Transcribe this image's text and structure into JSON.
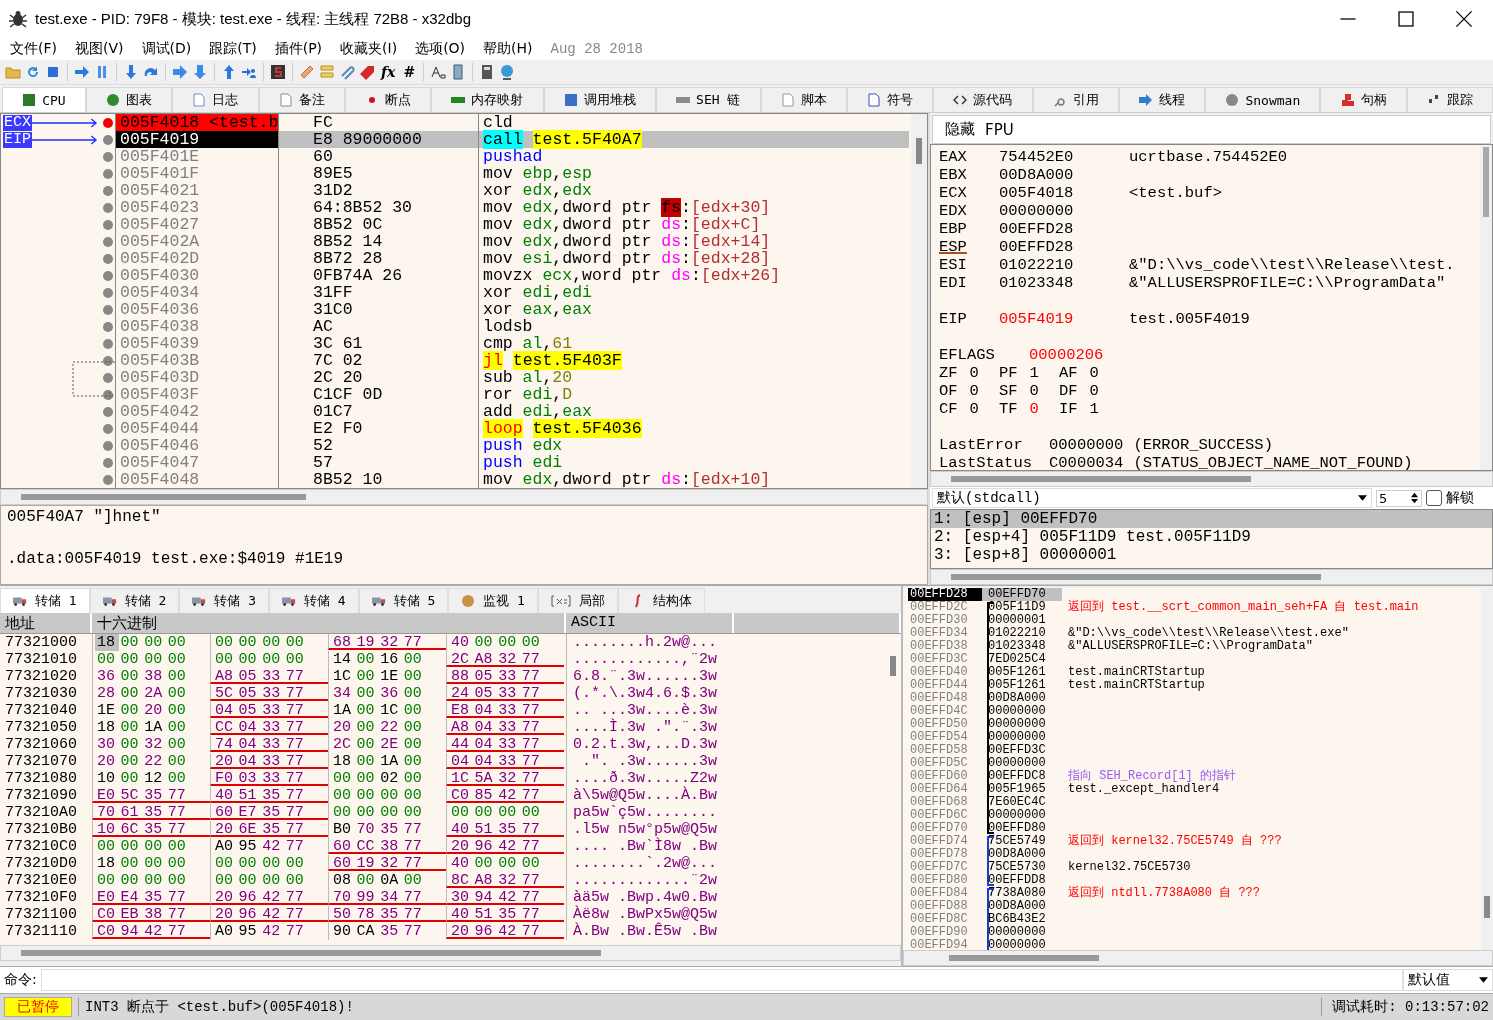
{
  "window": {
    "title": "test.exe - PID: 79F8 - 模块: test.exe - 线程: 主线程 72B8 - x32dbg"
  },
  "menu": [
    "文件(F)",
    "视图(V)",
    "调试(D)",
    "跟踪(T)",
    "插件(P)",
    "收藏夹(I)",
    "选项(O)",
    "帮助(H)"
  ],
  "build_date": "Aug 28 2018",
  "toolbar_glyphs": [
    "fx",
    "#"
  ],
  "tabs": [
    {
      "label": "CPU",
      "selected": true
    },
    {
      "label": "图表",
      "selected": false
    },
    {
      "label": "日志",
      "selected": false
    },
    {
      "label": "备注",
      "selected": false
    },
    {
      "label": "断点",
      "selected": false
    },
    {
      "label": "内存映射",
      "selected": false
    },
    {
      "label": "调用堆栈",
      "selected": false
    },
    {
      "label": "SEH 链",
      "selected": false
    },
    {
      "label": "脚本",
      "selected": false
    },
    {
      "label": "符号",
      "selected": false
    },
    {
      "label": "源代码",
      "selected": false
    },
    {
      "label": "引用",
      "selected": false
    },
    {
      "label": "线程",
      "selected": false
    },
    {
      "label": "Snowman",
      "selected": false
    },
    {
      "label": "句柄",
      "selected": false
    },
    {
      "label": "跟踪",
      "selected": false
    }
  ],
  "disassembly": {
    "rows": [
      {
        "pointer": "ECX",
        "address": "005F4018 <test.b",
        "bytes": "FC",
        "breakpoint": true,
        "current": false,
        "tokens": [
          {
            "kind": "op",
            "text": "cld"
          }
        ]
      },
      {
        "pointer": "EIP",
        "address": "005F4019",
        "bytes": "E8 89000000",
        "breakpoint": false,
        "current": true,
        "tokens": [
          {
            "kind": "call",
            "text": "call"
          },
          {
            "kind": "label",
            "text": "test.5F40A7"
          }
        ]
      },
      {
        "address": "005F401E",
        "bytes": "60",
        "breakpoint": false,
        "current": false,
        "tokens": [
          {
            "kind": "push",
            "text": "pushad"
          }
        ]
      },
      {
        "address": "005F401F",
        "bytes": "89E5",
        "breakpoint": false,
        "current": false,
        "tokens": [
          {
            "kind": "op",
            "text": "mov "
          },
          {
            "kind": "reg",
            "text": "ebp"
          },
          {
            "kind": "op",
            "text": ","
          },
          {
            "kind": "reg",
            "text": "esp"
          }
        ]
      },
      {
        "address": "005F4021",
        "bytes": "31D2",
        "breakpoint": false,
        "current": false,
        "tokens": [
          {
            "kind": "op",
            "text": "xor "
          },
          {
            "kind": "reg",
            "text": "edx"
          },
          {
            "kind": "op",
            "text": ","
          },
          {
            "kind": "reg",
            "text": "edx"
          }
        ]
      },
      {
        "address": "005F4023",
        "bytes": "64:8B52 30",
        "breakpoint": false,
        "current": false,
        "tokens": [
          {
            "kind": "op",
            "text": "mov "
          },
          {
            "kind": "reg",
            "text": "edx"
          },
          {
            "kind": "op",
            "text": ",dword ptr "
          },
          {
            "kind": "segx",
            "text": "fs"
          },
          {
            "kind": "op",
            "text": ":"
          },
          {
            "kind": "mem",
            "text": "[edx+30]"
          }
        ]
      },
      {
        "address": "005F4027",
        "bytes": "8B52 0C",
        "breakpoint": false,
        "current": false,
        "tokens": [
          {
            "kind": "op",
            "text": "mov "
          },
          {
            "kind": "reg",
            "text": "edx"
          },
          {
            "kind": "op",
            "text": ",dword ptr "
          },
          {
            "kind": "seg",
            "text": "ds"
          },
          {
            "kind": "op",
            "text": ":"
          },
          {
            "kind": "mem",
            "text": "[edx+C]"
          }
        ]
      },
      {
        "address": "005F402A",
        "bytes": "8B52 14",
        "breakpoint": false,
        "current": false,
        "tokens": [
          {
            "kind": "op",
            "text": "mov "
          },
          {
            "kind": "reg",
            "text": "edx"
          },
          {
            "kind": "op",
            "text": ",dword ptr "
          },
          {
            "kind": "seg",
            "text": "ds"
          },
          {
            "kind": "op",
            "text": ":"
          },
          {
            "kind": "mem",
            "text": "[edx+14]"
          }
        ]
      },
      {
        "address": "005F402D",
        "bytes": "8B72 28",
        "breakpoint": false,
        "current": false,
        "tokens": [
          {
            "kind": "op",
            "text": "mov "
          },
          {
            "kind": "reg",
            "text": "esi"
          },
          {
            "kind": "op",
            "text": ",dword ptr "
          },
          {
            "kind": "seg",
            "text": "ds"
          },
          {
            "kind": "op",
            "text": ":"
          },
          {
            "kind": "mem",
            "text": "[edx+28]"
          }
        ]
      },
      {
        "address": "005F4030",
        "bytes": "0FB74A 26",
        "breakpoint": false,
        "current": false,
        "tokens": [
          {
            "kind": "op",
            "text": "movzx "
          },
          {
            "kind": "reg",
            "text": "ecx"
          },
          {
            "kind": "op",
            "text": ",word ptr "
          },
          {
            "kind": "seg",
            "text": "ds"
          },
          {
            "kind": "op",
            "text": ":"
          },
          {
            "kind": "mem",
            "text": "[edx+26]"
          }
        ]
      },
      {
        "address": "005F4034",
        "bytes": "31FF",
        "breakpoint": false,
        "current": false,
        "tokens": [
          {
            "kind": "op",
            "text": "xor "
          },
          {
            "kind": "reg",
            "text": "edi"
          },
          {
            "kind": "op",
            "text": ","
          },
          {
            "kind": "reg",
            "text": "edi"
          }
        ]
      },
      {
        "address": "005F4036",
        "bytes": "31C0",
        "breakpoint": false,
        "current": false,
        "tokens": [
          {
            "kind": "op",
            "text": "xor "
          },
          {
            "kind": "reg",
            "text": "eax"
          },
          {
            "kind": "op",
            "text": ","
          },
          {
            "kind": "reg",
            "text": "eax"
          }
        ]
      },
      {
        "address": "005F4038",
        "bytes": "AC",
        "breakpoint": false,
        "current": false,
        "tokens": [
          {
            "kind": "op",
            "text": "lodsb"
          }
        ]
      },
      {
        "address": "005F4039",
        "bytes": "3C 61",
        "breakpoint": false,
        "current": false,
        "tokens": [
          {
            "kind": "op",
            "text": "cmp "
          },
          {
            "kind": "reg",
            "text": "al"
          },
          {
            "kind": "op",
            "text": ","
          },
          {
            "kind": "num",
            "text": "61"
          }
        ]
      },
      {
        "address": "005F403B",
        "bytes": "7C 02",
        "breakpoint": false,
        "current": false,
        "tokens": [
          {
            "kind": "jump",
            "text": "jl"
          },
          {
            "kind": "label",
            "text": "test.5F403F"
          }
        ]
      },
      {
        "address": "005F403D",
        "bytes": "2C 20",
        "breakpoint": false,
        "current": false,
        "tokens": [
          {
            "kind": "op",
            "text": "sub "
          },
          {
            "kind": "reg",
            "text": "al"
          },
          {
            "kind": "op",
            "text": ","
          },
          {
            "kind": "num",
            "text": "20"
          }
        ]
      },
      {
        "address": "005F403F",
        "bytes": "C1CF 0D",
        "breakpoint": false,
        "current": false,
        "tokens": [
          {
            "kind": "op",
            "text": "ror "
          },
          {
            "kind": "reg",
            "text": "edi"
          },
          {
            "kind": "op",
            "text": ","
          },
          {
            "kind": "num",
            "text": "D"
          }
        ]
      },
      {
        "address": "005F4042",
        "bytes": "01C7",
        "breakpoint": false,
        "current": false,
        "tokens": [
          {
            "kind": "op",
            "text": "add "
          },
          {
            "kind": "reg",
            "text": "edi"
          },
          {
            "kind": "op",
            "text": ","
          },
          {
            "kind": "reg",
            "text": "eax"
          }
        ]
      },
      {
        "address": "005F4044",
        "bytes": "E2 F0",
        "breakpoint": false,
        "current": false,
        "tokens": [
          {
            "kind": "jump",
            "text": "loop"
          },
          {
            "kind": "label",
            "text": "test.5F4036"
          }
        ]
      },
      {
        "address": "005F4046",
        "bytes": "52",
        "breakpoint": false,
        "current": false,
        "tokens": [
          {
            "kind": "push",
            "text": "push "
          },
          {
            "kind": "reg",
            "text": "edx"
          }
        ]
      },
      {
        "address": "005F4047",
        "bytes": "57",
        "breakpoint": false,
        "current": false,
        "tokens": [
          {
            "kind": "push",
            "text": "push "
          },
          {
            "kind": "reg",
            "text": "edi"
          }
        ]
      },
      {
        "address": "005F4048",
        "bytes": "8B52 10",
        "breakpoint": false,
        "current": false,
        "tokens": [
          {
            "kind": "op",
            "text": "mov "
          },
          {
            "kind": "reg",
            "text": "edx"
          },
          {
            "kind": "op",
            "text": ",dword ptr "
          },
          {
            "kind": "seg",
            "text": "ds"
          },
          {
            "kind": "op",
            "text": ":"
          },
          {
            "kind": "mem",
            "text": "[edx+10]"
          }
        ]
      }
    ]
  },
  "info_lines": [
    "005F40A7 \"]hnet\"",
    ".data:005F4019 test.exe:$4019 #1E19"
  ],
  "registers": {
    "buttons": [
      "隐藏",
      "FPU"
    ],
    "groups": [
      [
        {
          "name": "EAX",
          "value": "754452E0",
          "comment": "ucrtbase.754452E0",
          "changed": false,
          "marked": false
        },
        {
          "name": "EBX",
          "value": "00D8A000",
          "changed": false,
          "marked": false
        },
        {
          "name": "ECX",
          "value": "005F4018",
          "comment": "<test.buf>",
          "changed": false,
          "marked": false
        },
        {
          "name": "EDX",
          "value": "00000000",
          "changed": false,
          "marked": false
        },
        {
          "name": "EBP",
          "value": "00EFFD28",
          "changed": false,
          "marked": false
        },
        {
          "name": "ESP",
          "value": "00EFFD28",
          "changed": false,
          "marked": true
        },
        {
          "name": "ESI",
          "value": "01022210",
          "comment": "&\"D:\\\\vs_code\\\\test\\\\Release\\\\test.",
          "changed": false,
          "marked": false
        },
        {
          "name": "EDI",
          "value": "01023348",
          "comment": "&\"ALLUSERSPROFILE=C:\\\\ProgramData\"",
          "changed": false,
          "marked": false
        }
      ],
      [
        {
          "name": "EIP",
          "value": "005F4019",
          "comment": "test.005F4019",
          "changed": true,
          "marked": false
        }
      ]
    ],
    "eflags": {
      "name": "EFLAGS",
      "value": "00000206",
      "changed": true
    },
    "flags": [
      [
        {
          "name": "ZF",
          "value": "0",
          "changed": false
        },
        {
          "name": "PF",
          "value": "1",
          "changed": false
        },
        {
          "name": "AF",
          "value": "0",
          "changed": false
        }
      ],
      [
        {
          "name": "OF",
          "value": "0",
          "changed": false
        },
        {
          "name": "SF",
          "value": "0",
          "changed": false
        },
        {
          "name": "DF",
          "value": "0",
          "changed": false
        }
      ],
      [
        {
          "name": "CF",
          "value": "0",
          "changed": false
        },
        {
          "name": "TF",
          "value": "0",
          "changed": true
        },
        {
          "name": "IF",
          "value": "1",
          "changed": false
        }
      ]
    ],
    "status": [
      {
        "name": "LastError",
        "value": "00000000",
        "note": "(ERROR_SUCCESS)"
      },
      {
        "name": "LastStatus",
        "value": "C0000034",
        "note": "(STATUS_OBJECT_NAME_NOT_FOUND)"
      }
    ]
  },
  "arguments": {
    "convention": "默认(stdcall)",
    "count": "5",
    "unlock": {
      "label": "解锁",
      "checked": false
    },
    "rows": [
      {
        "text": "1: [esp] 00EFFD70",
        "selected": true
      },
      {
        "text": "2: [esp+4] 005F11D9 test.005F11D9",
        "selected": false
      },
      {
        "text": "3: [esp+8] 00000001",
        "selected": false
      }
    ]
  },
  "dump": {
    "tabs": [
      {
        "label": "转储 1",
        "selected": true
      },
      {
        "label": "转储 2",
        "selected": false
      },
      {
        "label": "转储 3",
        "selected": false
      },
      {
        "label": "转储 4",
        "selected": false
      },
      {
        "label": "转储 5",
        "selected": false
      },
      {
        "label": "监视 1",
        "selected": false
      },
      {
        "label": "局部",
        "selected": false
      },
      {
        "label": "结构体",
        "selected": false
      }
    ],
    "columns": [
      "地址",
      "十六进制",
      "ASCII"
    ],
    "rows": [
      {
        "address": "77321000",
        "selected": true,
        "groups": [
          {
            "bytes": "18 00 00 00",
            "pointer": false
          },
          {
            "bytes": "00 00 00 00",
            "pointer": false
          },
          {
            "bytes": "68 19 32 77",
            "pointer": true
          },
          {
            "bytes": "40 00 00 00",
            "pointer": false
          }
        ],
        "ascii": "........h.2w@..."
      },
      {
        "address": "77321010",
        "selected": false,
        "groups": [
          {
            "bytes": "00 00 00 00",
            "pointer": false
          },
          {
            "bytes": "00 00 00 00",
            "pointer": false
          },
          {
            "bytes": "14 00 16 00",
            "pointer": false
          },
          {
            "bytes": "2C A8 32 77",
            "pointer": true
          }
        ],
        "ascii": "............,¨2w"
      },
      {
        "address": "77321020",
        "selected": false,
        "groups": [
          {
            "bytes": "36 00 38 00",
            "pointer": false
          },
          {
            "bytes": "A8 05 33 77",
            "pointer": true
          },
          {
            "bytes": "1C 00 1E 00",
            "pointer": false
          },
          {
            "bytes": "88 05 33 77",
            "pointer": true
          }
        ],
        "ascii": "6.8.¨.3w......3w"
      },
      {
        "address": "77321030",
        "selected": false,
        "groups": [
          {
            "bytes": "28 00 2A 00",
            "pointer": false
          },
          {
            "bytes": "5C 05 33 77",
            "pointer": true
          },
          {
            "bytes": "34 00 36 00",
            "pointer": false
          },
          {
            "bytes": "24 05 33 77",
            "pointer": true
          }
        ],
        "ascii": "(.*.\\.3w4.6.$.3w"
      },
      {
        "address": "77321040",
        "selected": false,
        "groups": [
          {
            "bytes": "1E 00 20 00",
            "pointer": false
          },
          {
            "bytes": "04 05 33 77",
            "pointer": true
          },
          {
            "bytes": "1A 00 1C 00",
            "pointer": false
          },
          {
            "bytes": "E8 04 33 77",
            "pointer": true
          }
        ],
        "ascii": ".. ...3w....è.3w"
      },
      {
        "address": "77321050",
        "selected": false,
        "groups": [
          {
            "bytes": "18 00 1A 00",
            "pointer": false
          },
          {
            "bytes": "CC 04 33 77",
            "pointer": true
          },
          {
            "bytes": "20 00 22 00",
            "pointer": false
          },
          {
            "bytes": "A8 04 33 77",
            "pointer": true
          }
        ],
        "ascii": "....Ì.3w .\".¨.3w"
      },
      {
        "address": "77321060",
        "selected": false,
        "groups": [
          {
            "bytes": "30 00 32 00",
            "pointer": false
          },
          {
            "bytes": "74 04 33 77",
            "pointer": true
          },
          {
            "bytes": "2C 00 2E 00",
            "pointer": false
          },
          {
            "bytes": "44 04 33 77",
            "pointer": true
          }
        ],
        "ascii": "0.2.t.3w,...D.3w"
      },
      {
        "address": "77321070",
        "selected": false,
        "groups": [
          {
            "bytes": "20 00 22 00",
            "pointer": false
          },
          {
            "bytes": "20 04 33 77",
            "pointer": true
          },
          {
            "bytes": "18 00 1A 00",
            "pointer": false
          },
          {
            "bytes": "04 04 33 77",
            "pointer": true
          }
        ],
        "ascii": " .\". .3w......3w"
      },
      {
        "address": "77321080",
        "selected": false,
        "groups": [
          {
            "bytes": "10 00 12 00",
            "pointer": false
          },
          {
            "bytes": "F0 03 33 77",
            "pointer": true
          },
          {
            "bytes": "00 00 02 00",
            "pointer": false
          },
          {
            "bytes": "1C 5A 32 77",
            "pointer": true
          }
        ],
        "ascii": "....ð.3w.....Z2w"
      },
      {
        "address": "77321090",
        "selected": false,
        "groups": [
          {
            "bytes": "E0 5C 35 77",
            "pointer": true
          },
          {
            "bytes": "40 51 35 77",
            "pointer": true
          },
          {
            "bytes": "00 00 00 00",
            "pointer": false
          },
          {
            "bytes": "C0 85 42 77",
            "pointer": true
          }
        ],
        "ascii": "à\\5w@Q5w....À.Bw"
      },
      {
        "address": "773210A0",
        "selected": false,
        "groups": [
          {
            "bytes": "70 61 35 77",
            "pointer": true
          },
          {
            "bytes": "60 E7 35 77",
            "pointer": true
          },
          {
            "bytes": "00 00 00 00",
            "pointer": false
          },
          {
            "bytes": "00 00 00 00",
            "pointer": false
          }
        ],
        "ascii": "pa5w`ç5w........"
      },
      {
        "address": "773210B0",
        "selected": false,
        "groups": [
          {
            "bytes": "10 6C 35 77",
            "pointer": true
          },
          {
            "bytes": "20 6E 35 77",
            "pointer": true
          },
          {
            "bytes": "B0 70 35 77",
            "pointer": false
          },
          {
            "bytes": "40 51 35 77",
            "pointer": true
          }
        ],
        "ascii": ".l5w n5w°p5w@Q5w"
      },
      {
        "address": "773210C0",
        "selected": false,
        "groups": [
          {
            "bytes": "00 00 00 00",
            "pointer": false
          },
          {
            "bytes": "A0 95 42 77",
            "pointer": false
          },
          {
            "bytes": "60 CC 38 77",
            "pointer": true
          },
          {
            "bytes": "20 96 42 77",
            "pointer": true
          }
        ],
        "ascii": ".... .Bw`Ì8w .Bw"
      },
      {
        "address": "773210D0",
        "selected": false,
        "groups": [
          {
            "bytes": "18 00 00 00",
            "pointer": false
          },
          {
            "bytes": "00 00 00 00",
            "pointer": false
          },
          {
            "bytes": "60 19 32 77",
            "pointer": true
          },
          {
            "bytes": "40 00 00 00",
            "pointer": false
          }
        ],
        "ascii": "........`.2w@..."
      },
      {
        "address": "773210E0",
        "selected": false,
        "groups": [
          {
            "bytes": "00 00 00 00",
            "pointer": false
          },
          {
            "bytes": "00 00 00 00",
            "pointer": false
          },
          {
            "bytes": "08 00 0A 00",
            "pointer": false
          },
          {
            "bytes": "8C A8 32 77",
            "pointer": true
          }
        ],
        "ascii": ".............¨2w"
      },
      {
        "address": "773210F0",
        "selected": false,
        "groups": [
          {
            "bytes": "E0 E4 35 77",
            "pointer": true
          },
          {
            "bytes": "20 96 42 77",
            "pointer": true
          },
          {
            "bytes": "70 99 34 77",
            "pointer": true
          },
          {
            "bytes": "30 94 42 77",
            "pointer": true
          }
        ],
        "ascii": "àä5w .Bwp.4w0.Bw"
      },
      {
        "address": "77321100",
        "selected": false,
        "groups": [
          {
            "bytes": "C0 EB 38 77",
            "pointer": true
          },
          {
            "bytes": "20 96 42 77",
            "pointer": true
          },
          {
            "bytes": "50 78 35 77",
            "pointer": true
          },
          {
            "bytes": "40 51 35 77",
            "pointer": true
          }
        ],
        "ascii": "Àë8w .BwPx5w@Q5w"
      },
      {
        "address": "77321110",
        "selected": false,
        "groups": [
          {
            "bytes": "C0 94 42 77",
            "pointer": true
          },
          {
            "bytes": "A0 95 42 77",
            "pointer": false
          },
          {
            "bytes": "90 CA 35 77",
            "pointer": false
          },
          {
            "bytes": "20 96 42 77",
            "pointer": true
          }
        ],
        "ascii": "À.Bw .Bw.Ê5w .Bw"
      }
    ]
  },
  "stack": {
    "top": {
      "address": "00EFFD28",
      "value": "00EFFD70"
    },
    "frames": [
      {
        "color": "#000000",
        "closed": true,
        "rows": [
          {
            "address": "00EFFD2C",
            "value": "005F11D9",
            "comment": "返回到 test.__scrt_common_main_seh+FA 自 test.main",
            "kind": "return"
          },
          {
            "address": "00EFFD30",
            "value": "00000001"
          },
          {
            "address": "00EFFD34",
            "value": "01022210",
            "comment": "&\"D:\\\\vs_code\\\\test\\\\Release\\\\test.exe\"",
            "kind": "plain"
          },
          {
            "address": "00EFFD38",
            "value": "01023348",
            "comment": "&\"ALLUSERSPROFILE=C:\\\\ProgramData\"",
            "kind": "plain"
          },
          {
            "address": "00EFFD3C",
            "value": "7ED025C4"
          },
          {
            "address": "00EFFD40",
            "value": "005F1261",
            "comment": "test.mainCRTStartup",
            "kind": "plain"
          },
          {
            "address": "00EFFD44",
            "value": "005F1261",
            "comment": "test.mainCRTStartup",
            "kind": "plain"
          },
          {
            "address": "00EFFD48",
            "value": "00D8A000"
          },
          {
            "address": "00EFFD4C",
            "value": "00000000"
          },
          {
            "address": "00EFFD50",
            "value": "00000000"
          },
          {
            "address": "00EFFD54",
            "value": "00000000"
          },
          {
            "address": "00EFFD58",
            "value": "00EFFD3C"
          },
          {
            "address": "00EFFD5C",
            "value": "00000000"
          },
          {
            "address": "00EFFD60",
            "value": "00EFFDC8",
            "comment": "指向 SEH_Record[1] 的指针",
            "kind": "seh"
          },
          {
            "address": "00EFFD64",
            "value": "005F1965",
            "comment": "test._except_handler4",
            "kind": "plain"
          },
          {
            "address": "00EFFD68",
            "value": "7E60EC4C"
          },
          {
            "address": "00EFFD6C",
            "value": "00000000"
          },
          {
            "address": "00EFFD70",
            "value": "00EFFD80"
          }
        ]
      },
      {
        "color": "#1a3cc8",
        "closed": true,
        "rows": [
          {
            "address": "00EFFD74",
            "value": "75CE5749",
            "comment": "返回到 kernel32.75CE5749 自 ???",
            "kind": "return"
          },
          {
            "address": "00EFFD78",
            "value": "00D8A000"
          },
          {
            "address": "00EFFD7C",
            "value": "75CE5730",
            "comment": "kernel32.75CE5730",
            "kind": "plain"
          },
          {
            "address": "00EFFD80",
            "value": "00EFFDD8"
          }
        ]
      },
      {
        "color": "#1a3cc8",
        "closed": false,
        "rows": [
          {
            "address": "00EFFD84",
            "value": "7738A080",
            "comment": "返回到 ntdll.7738A080 自 ???",
            "kind": "return"
          },
          {
            "address": "00EFFD88",
            "value": "00D8A000"
          },
          {
            "address": "00EFFD8C",
            "value": "BC6B43E2"
          },
          {
            "address": "00EFFD90",
            "value": "00000000"
          },
          {
            "address": "00EFFD94",
            "value": "00000000"
          }
        ]
      }
    ]
  },
  "command": {
    "label": "命令:",
    "mode": "默认值"
  },
  "status_bar": {
    "state": "已暂停",
    "message": "INT3 断点于 <test.buf>(005F4018)!",
    "elapsed": "调试耗时: 0:13:57:02"
  }
}
